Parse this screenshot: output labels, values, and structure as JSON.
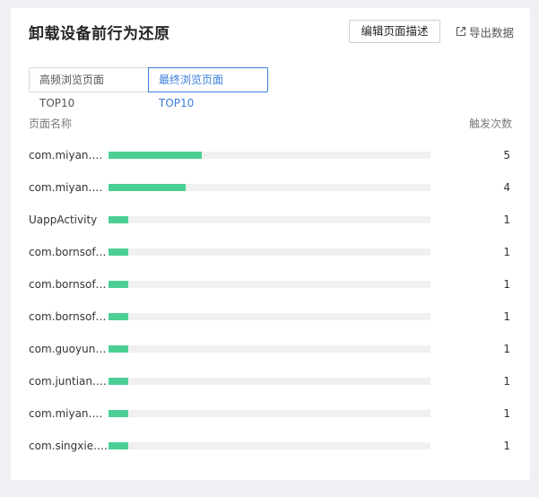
{
  "header": {
    "title": "卸载设备前行为还原",
    "edit_label": "编辑页面描述",
    "export_label": "导出数据"
  },
  "tabs": [
    {
      "label": "高频浏览页面TOP10",
      "active": false
    },
    {
      "label": "最终浏览页面TOP10",
      "active": true
    }
  ],
  "table": {
    "col_name": "页面名称",
    "col_count": "触发次数",
    "max": 5,
    "rows": [
      {
        "name": "com.miyan.ui...",
        "value": 5,
        "share": 0.29
      },
      {
        "name": "com.miyan.ui...",
        "value": 4,
        "share": 0.24
      },
      {
        "name": "UappActivity",
        "value": 1,
        "share": 0.06
      },
      {
        "name": "com.bornsoft...",
        "value": 1,
        "share": 0.06
      },
      {
        "name": "com.bornsoft...",
        "value": 1,
        "share": 0.06
      },
      {
        "name": "com.bornsoft...",
        "value": 1,
        "share": 0.06
      },
      {
        "name": "com.guoyunc...",
        "value": 1,
        "share": 0.06
      },
      {
        "name": "com.juntian.r...",
        "value": 1,
        "share": 0.06
      },
      {
        "name": "com.miyan.ui...",
        "value": 1,
        "share": 0.06
      },
      {
        "name": "com.singxie.i...",
        "value": 1,
        "share": 0.06
      }
    ]
  },
  "colors": {
    "accent": "#3b7ddd",
    "bar": "#4ccf94",
    "track": "#f0f0f0"
  }
}
